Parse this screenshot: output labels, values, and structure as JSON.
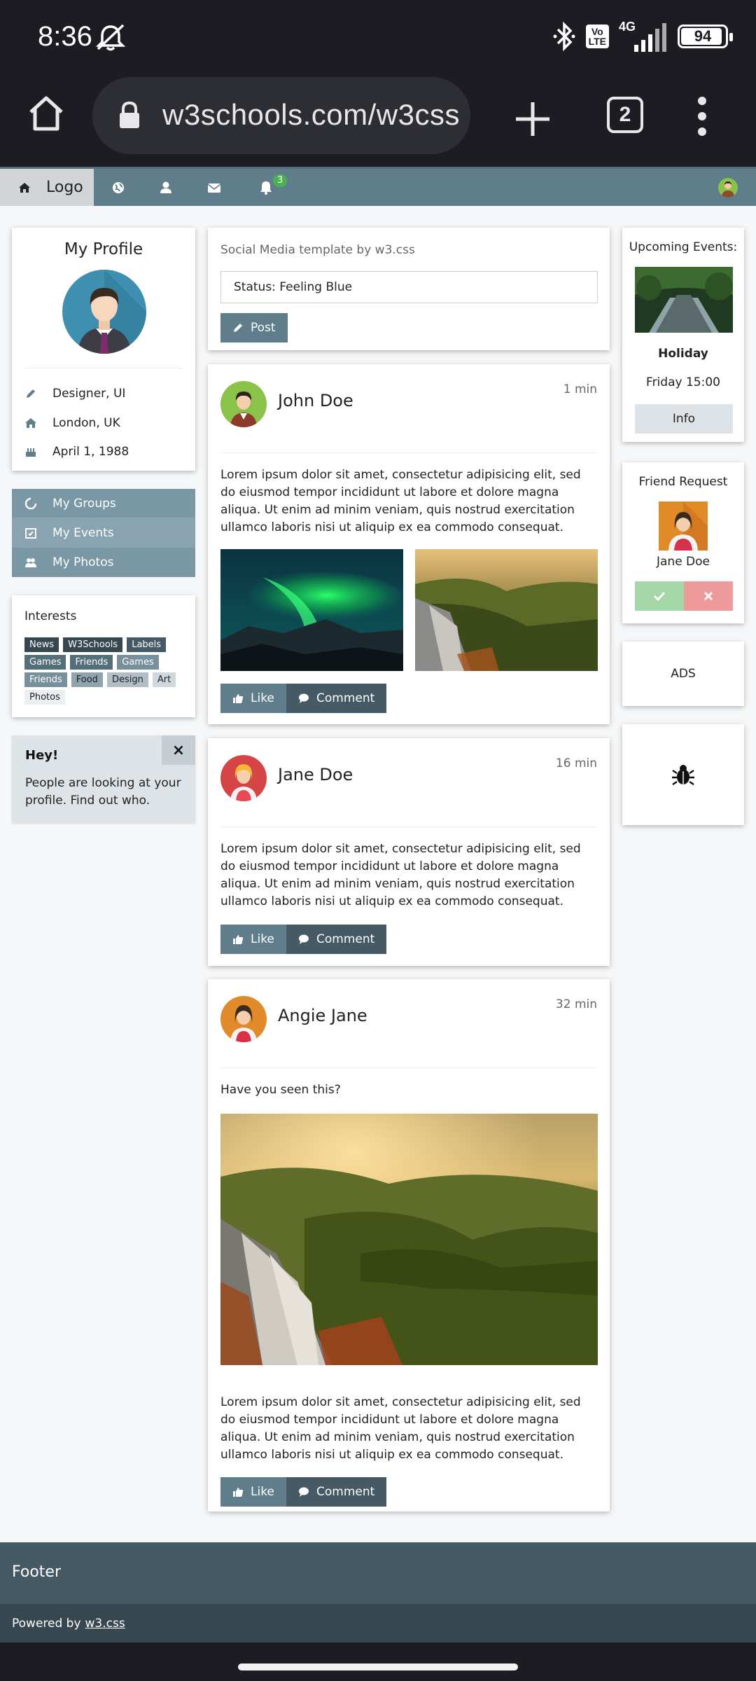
{
  "status_bar": {
    "time": "8:36",
    "volte": "Vo\nLTE",
    "network": "4G",
    "battery": "94"
  },
  "browser": {
    "url": "w3schools.com/w3css",
    "tab_count": "2"
  },
  "topnav": {
    "logo_label": "Logo",
    "notification_count": "3"
  },
  "profile": {
    "title": "My Profile",
    "job": "Designer, UI",
    "location": "London, UK",
    "birthday": "April 1, 1988"
  },
  "menu": {
    "groups": "My Groups",
    "events": "My Events",
    "photos": "My Photos"
  },
  "interests": {
    "title": "Interests",
    "tags": [
      "News",
      "W3Schools",
      "Labels",
      "Games",
      "Friends",
      "Games",
      "Friends",
      "Food",
      "Design",
      "Art",
      "Photos"
    ]
  },
  "alert": {
    "close": "×",
    "title": "Hey!",
    "text": "People are looking at your profile. Find out who."
  },
  "compose": {
    "label": "Social Media template by w3.css",
    "status_value": "Status: Feeling Blue",
    "post_button": "Post"
  },
  "posts": [
    {
      "name": "John Doe",
      "time": "1 min",
      "text": "Lorem ipsum dolor sit amet, consectetur adipisicing elit, sed do eiusmod tempor incididunt ut labore et dolore magna aliqua. Ut enim ad minim veniam, quis nostrud exercitation ullamco laboris nisi ut aliquip ex ea commodo consequat."
    },
    {
      "name": "Jane Doe",
      "time": "16 min",
      "text": "Lorem ipsum dolor sit amet, consectetur adipisicing elit, sed do eiusmod tempor incididunt ut labore et dolore magna aliqua. Ut enim ad minim veniam, quis nostrud exercitation ullamco laboris nisi ut aliquip ex ea commodo consequat."
    },
    {
      "name": "Angie Jane",
      "time": "32 min",
      "intro": "Have you seen this?",
      "text": "Lorem ipsum dolor sit amet, consectetur adipisicing elit, sed do eiusmod tempor incididunt ut labore et dolore magna aliqua. Ut enim ad minim veniam, quis nostrud exercitation ullamco laboris nisi ut aliquip ex ea commodo consequat."
    }
  ],
  "actions": {
    "like": "Like",
    "comment": "Comment"
  },
  "events": {
    "title": "Upcoming Events:",
    "name": "Holiday",
    "when": "Friday 15:00",
    "info_button": "Info"
  },
  "friend_request": {
    "title": "Friend Request",
    "name": "Jane Doe"
  },
  "ads": {
    "label": "ADS"
  },
  "footer": {
    "title": "Footer",
    "powered_prefix": "Powered by",
    "powered_link": "w3.css"
  },
  "colors": {
    "theme": "#607d8b",
    "theme_dark": "#455a64",
    "accept": "#a5d6a7",
    "decline": "#ef9a9a",
    "badge": "#4caf50"
  }
}
